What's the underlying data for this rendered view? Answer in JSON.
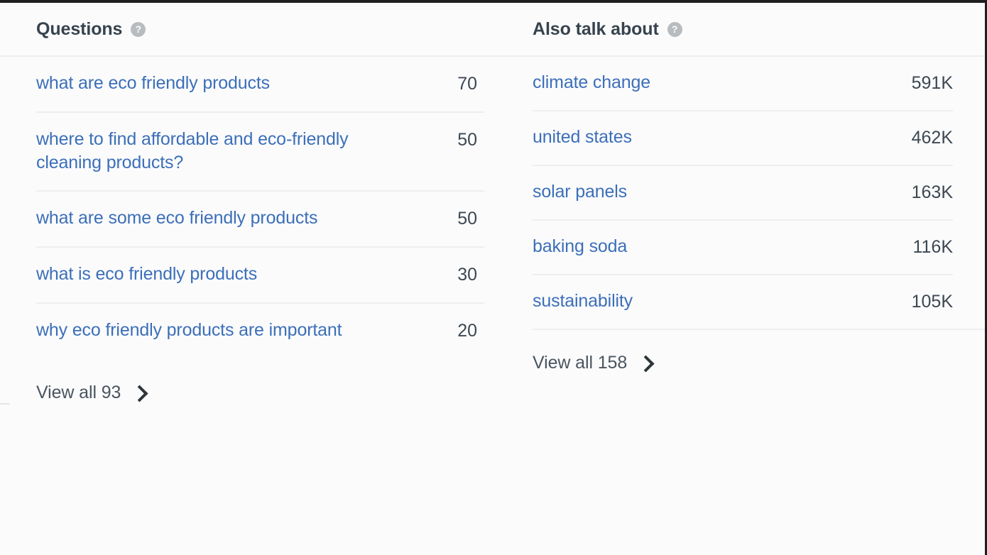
{
  "theme": {
    "link_color": "#3c6fb8",
    "value_color": "#3d4852",
    "title_color": "#37434d",
    "divider_color": "#eceef0",
    "background": "#fbfbfc",
    "help_icon_bg": "#b9bcbf"
  },
  "panels": [
    {
      "id": "questions",
      "title": "Questions",
      "help_icon": "question-mark-circle-icon",
      "rows": [
        {
          "label": "what are eco friendly products",
          "value": "70"
        },
        {
          "label": "where to find affordable and eco-friendly cleaning products?",
          "value": "50"
        },
        {
          "label": "what are some eco friendly products",
          "value": "50"
        },
        {
          "label": "what is eco friendly products",
          "value": "30"
        },
        {
          "label": "why eco friendly products are important",
          "value": "20"
        }
      ],
      "view_all": {
        "label": "View all 93",
        "count": "93",
        "chevron_icon": "chevron-right-icon"
      }
    },
    {
      "id": "also-talk-about",
      "title": "Also talk about",
      "help_icon": "question-mark-circle-icon",
      "rows": [
        {
          "label": "climate change",
          "value": "591K"
        },
        {
          "label": "united states",
          "value": "462K"
        },
        {
          "label": "solar panels",
          "value": "163K"
        },
        {
          "label": "baking soda",
          "value": "116K"
        },
        {
          "label": "sustainability",
          "value": "105K"
        }
      ],
      "view_all": {
        "label": "View all 158",
        "count": "158",
        "chevron_icon": "chevron-right-icon"
      }
    }
  ]
}
